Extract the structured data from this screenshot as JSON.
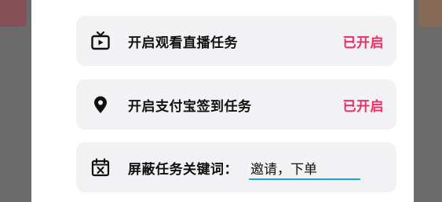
{
  "rows": [
    {
      "icon": "tv-icon",
      "label": "开启观看直播任务",
      "status": "已开启"
    },
    {
      "icon": "location-pin-icon",
      "label": "开启支付宝签到任务",
      "status": "已开启"
    },
    {
      "icon": "calendar-x-icon",
      "label": "屏蔽任务关键词：",
      "input_value": "邀请，下单"
    }
  ],
  "colors": {
    "status_accent": "#ee2c64",
    "input_underline": "#1aa5d8",
    "row_background": "#f2f2f4"
  }
}
